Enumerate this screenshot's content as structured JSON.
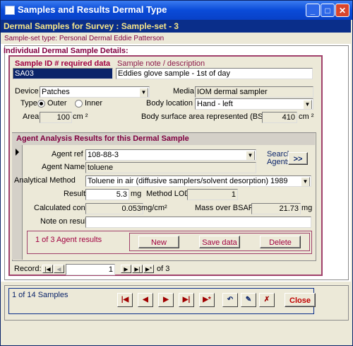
{
  "window": {
    "title": "Samples and Results Dermal Type",
    "minimize": "_",
    "maximize": "□",
    "close": "✕"
  },
  "header": {
    "survey": "Dermal Samples for Survey : Sample-set - 3",
    "subheader": "Sample-set type: Personal Dermal  Eddie Patterson",
    "section": "Individual Dermal Sample Details:"
  },
  "sample": {
    "id_label": "Sample ID # required data",
    "id_value": "SA03",
    "note_label": "Sample note / description",
    "note_value": "Eddies glove sample - 1st of day",
    "device_label": "Device",
    "device_value": "Patches",
    "media_label": "Media",
    "media_value": "IOM dermal sampler",
    "type_label": "Type",
    "type_outer": "Outer",
    "type_inner": "Inner",
    "type_selected": "Outer",
    "body_location_label": "Body location",
    "body_location_value": "Hand - left",
    "area_label": "Area",
    "area_value": "100",
    "area_unit": "cm ²",
    "bsar_label": "Body surface area represented (BSAR)",
    "bsar_value": "410",
    "bsar_unit": "cm ²"
  },
  "agent": {
    "section_title": "Agent Analysis Results for this Dermal Sample",
    "ref_label": "Agent  ref",
    "ref_value": "108-88-3",
    "search_label": "Search Agents",
    "search_button": ">>",
    "name_label": "Agent Name",
    "name_value": "toluene",
    "method_label": "Analytical Method",
    "method_value": "Toluene in air (diffusive samplers/solvent desorption) 1989",
    "result_label": "Result",
    "result_value": "5.3",
    "result_unit": "mg",
    "lod_label": "Method LOD",
    "lod_value": "1",
    "calc_label": "Calculated conc",
    "calc_value": "0.053",
    "calc_unit": "mg/cm²",
    "mass_label": "Mass over BSAR",
    "mass_value": "21.73",
    "mass_unit": "mg",
    "note_label": "Note on result",
    "note_value": "",
    "count_text": "1 of 3 Agent results",
    "new_button": "New",
    "save_button": "Save data",
    "delete_button": "Delete"
  },
  "record_nav": {
    "label": "Record:",
    "current": "1",
    "of_text": "of  3"
  },
  "footer": {
    "count_text": "1 of 14 Samples",
    "close_button": "Close"
  }
}
